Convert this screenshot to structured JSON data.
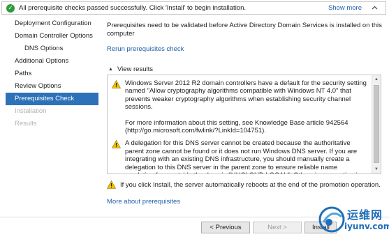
{
  "banner": {
    "message": "All prerequisite checks passed successfully.  Click 'Install' to begin installation.",
    "show_more": "Show more",
    "ok_icon": "check-circle-icon",
    "collapse_icon": "chevron-up-icon"
  },
  "nav": {
    "items": [
      {
        "label": "Deployment Configuration",
        "state": "normal"
      },
      {
        "label": "Domain Controller Options",
        "state": "normal"
      },
      {
        "label": "DNS Options",
        "state": "sub"
      },
      {
        "label": "Additional Options",
        "state": "normal"
      },
      {
        "label": "Paths",
        "state": "normal"
      },
      {
        "label": "Review Options",
        "state": "normal"
      },
      {
        "label": "Prerequisites Check",
        "state": "active"
      },
      {
        "label": "Installation",
        "state": "disabled"
      },
      {
        "label": "Results",
        "state": "disabled"
      }
    ]
  },
  "main": {
    "intro": "Prerequisites need to be validated before Active Directory Domain Services is installed on this computer",
    "rerun_link": "Rerun prerequisites check",
    "view_results_label": "View results",
    "results": [
      {
        "icon": "warning-icon",
        "paragraphs": [
          "Windows Server 2012 R2 domain controllers have a default for the security setting named \"Allow cryptography algorithms compatible with Windows NT 4.0\" that prevents weaker cryptography algorithms when establishing security channel sessions.",
          "For more information about this setting, see Knowledge Base article 942564 (http://go.microsoft.com/fwlink/?LinkId=104751)."
        ]
      },
      {
        "icon": "warning-icon",
        "paragraphs": [
          "A delegation for this DNS server cannot be created because the authoritative parent zone cannot be found or it does not run Windows DNS server. If you are integrating with an existing DNS infrastructure, you should manually create a delegation to this DNS server in the parent zone to ensure reliable name resolution from outside the domain \"HHCLOUD.LOCAL\". Otherwise, no action is required."
        ]
      }
    ],
    "reboot_note": "If you click Install, the server automatically reboots at the end of the promotion operation.",
    "more_link": "More about prerequisites"
  },
  "footer": {
    "previous": "< Previous",
    "next": "Next >",
    "install": "Install"
  },
  "watermark": {
    "line1": "运维网",
    "line2": "iyunv.com"
  },
  "colors": {
    "accent": "#2d72b8",
    "link": "#1f5fa8",
    "success": "#2e9b3a",
    "warning": "#f2c200"
  }
}
